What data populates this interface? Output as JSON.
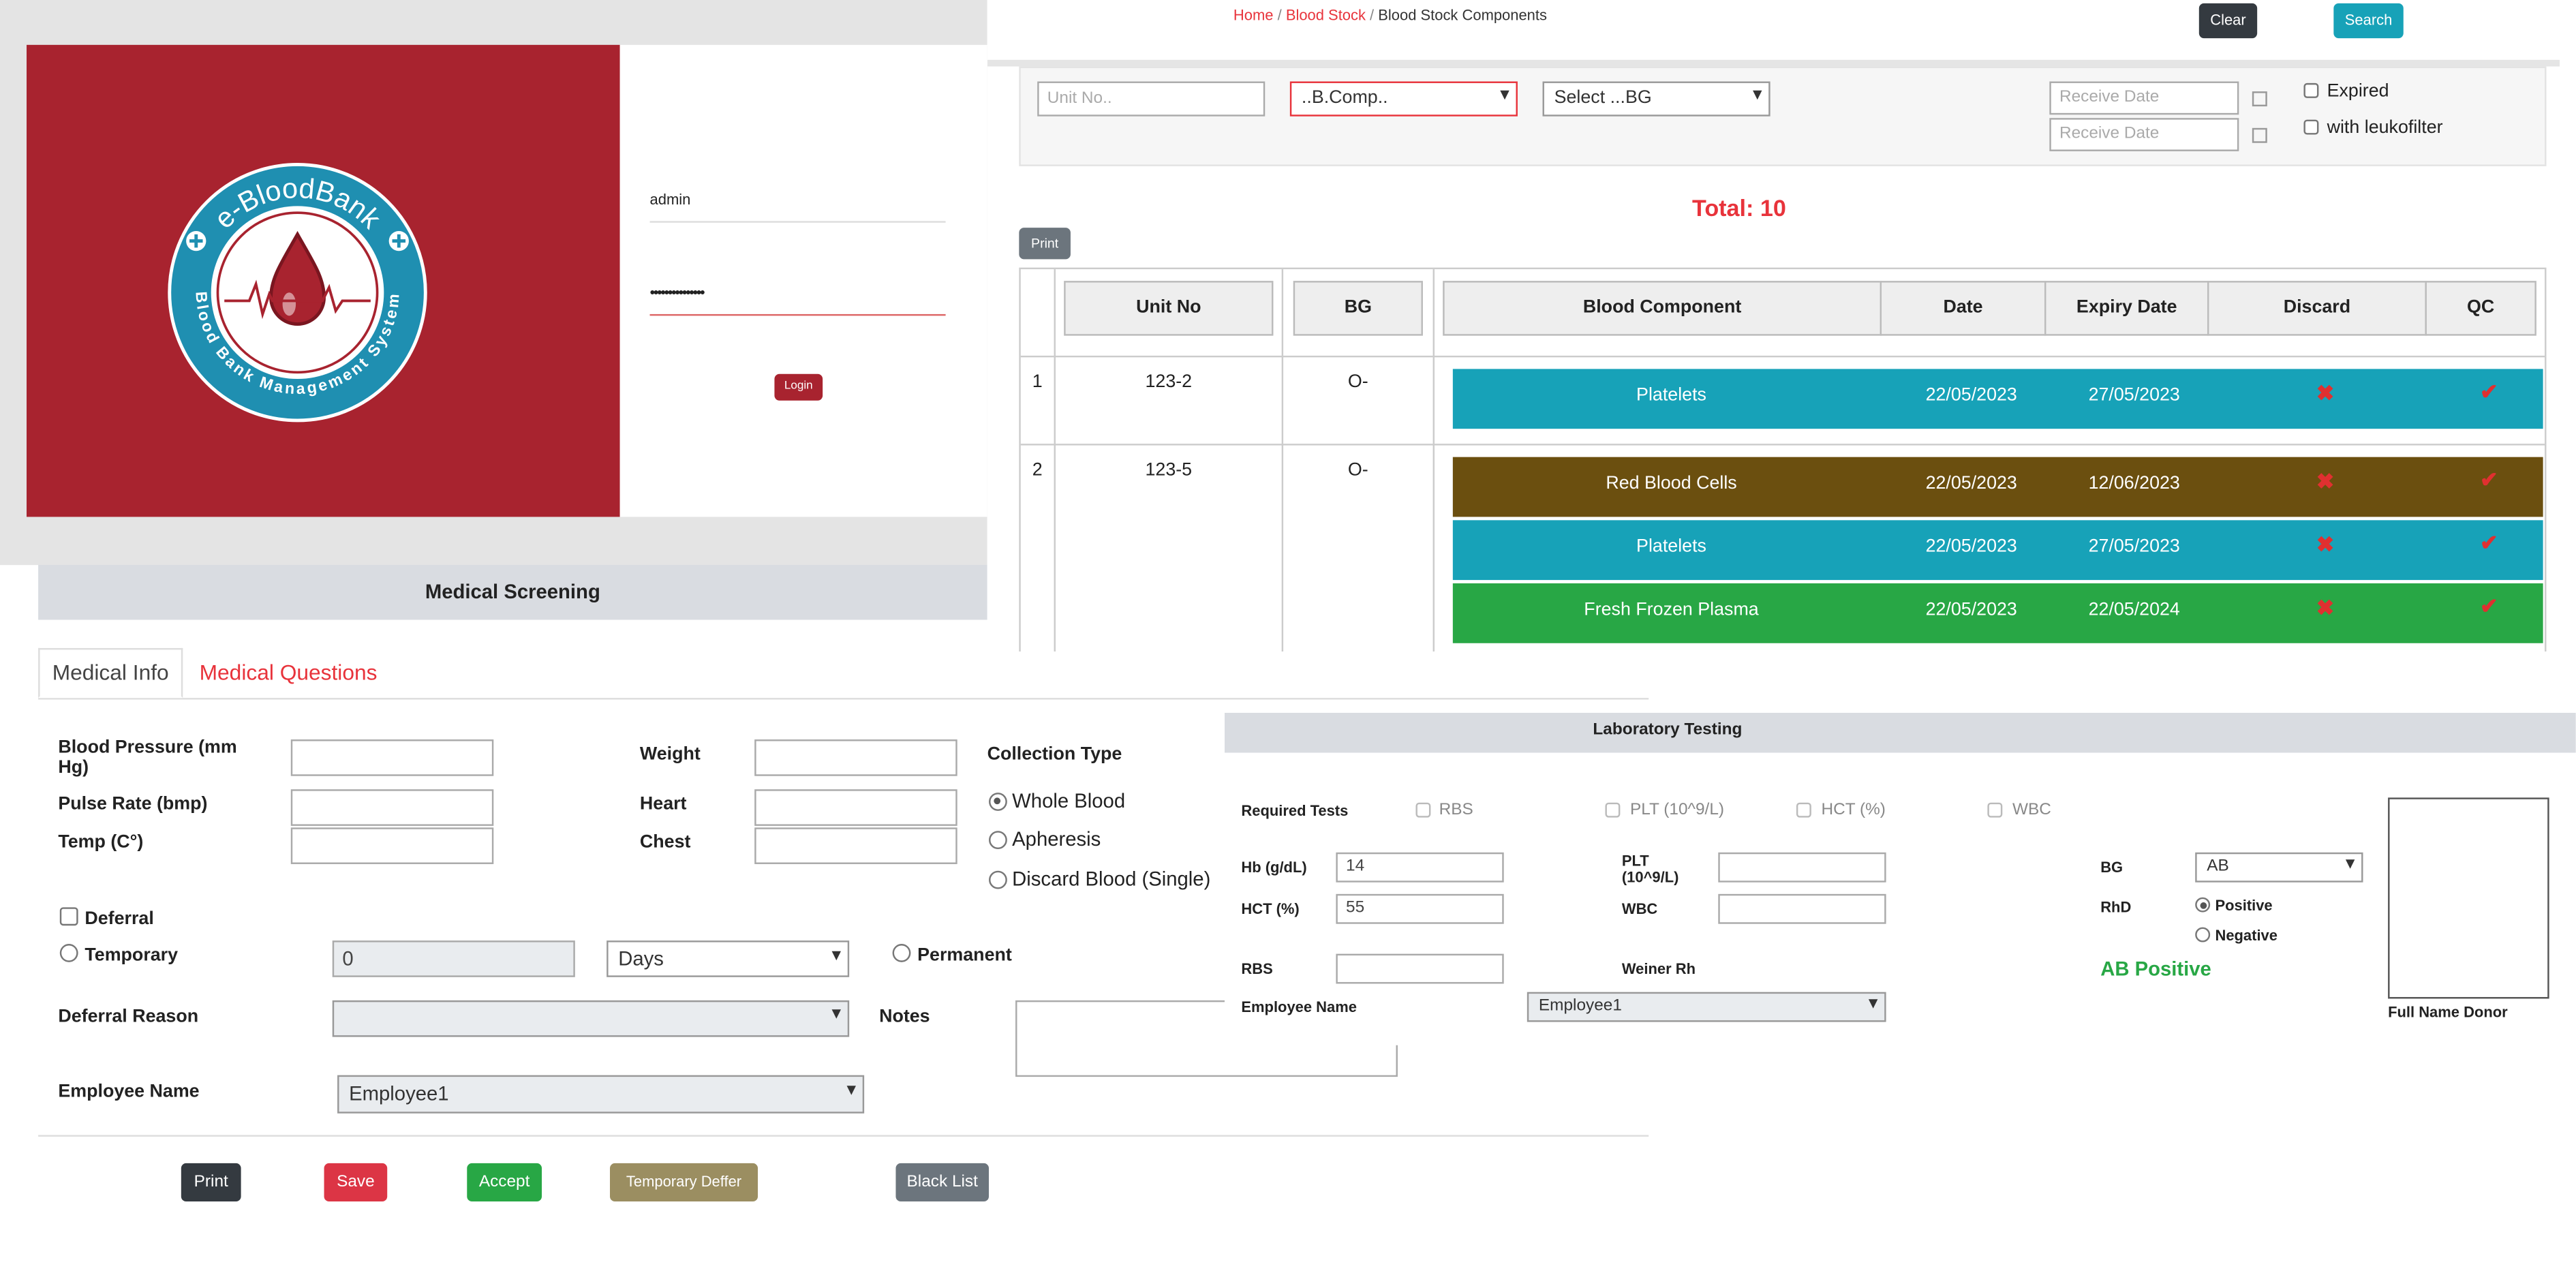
{
  "login": {
    "logo_text": "e-BloodBank",
    "logo_subtext": "Blood Bank Management System",
    "username": "admin",
    "password": "•••••••••••••••",
    "login_label": "Login"
  },
  "stock": {
    "breadcrumb": [
      "Home",
      "Blood Stock",
      "Blood Stock Components"
    ],
    "clear_label": "Clear",
    "search_label": "Search",
    "filters": {
      "unit_placeholder": "Unit No..",
      "component_select": "..B.Comp..",
      "bg_select": "Select ...BG",
      "receive_date_from_placeholder": "Receive Date",
      "receive_date_to_placeholder": "Receive Date",
      "expired_label": "Expired",
      "leukofilter_label": "with leukofilter"
    },
    "total_label": "Total: 10",
    "print_label": "Print",
    "columns": [
      "Unit No",
      "BG",
      "Blood Component",
      "Date",
      "Expiry Date",
      "Discard",
      "QC"
    ],
    "units": [
      {
        "index": "1",
        "unit_no": "123-2",
        "bg": "O-",
        "components": [
          {
            "name": "Platelets",
            "date": "22/05/2023",
            "expiry": "27/05/2023",
            "color": "#17a2b8"
          }
        ]
      },
      {
        "index": "2",
        "unit_no": "123-5",
        "bg": "O-",
        "components": [
          {
            "name": "Red Blood Cells",
            "date": "22/05/2023",
            "expiry": "12/06/2023",
            "color": "#6b4f0f"
          },
          {
            "name": "Platelets",
            "date": "22/05/2023",
            "expiry": "27/05/2023",
            "color": "#17a2b8"
          },
          {
            "name": "Fresh Frozen Plasma",
            "date": "22/05/2023",
            "expiry": "22/05/2024",
            "color": "#28a745"
          }
        ]
      }
    ]
  },
  "screening": {
    "title": "Medical Screening",
    "tabs": [
      "Medical Info",
      "Medical Questions"
    ],
    "blood_pressure_label": "Blood Pressure (mm Hg)",
    "pulse_label": "Pulse Rate (bmp)",
    "temp_label": "Temp (C°)",
    "weight_label": "Weight",
    "heart_label": "Heart",
    "chest_label": "Chest",
    "collection_type_label": "Collection Type",
    "collection_options": [
      "Whole Blood",
      "Apheresis",
      "Discard Blood (Single)"
    ],
    "deferral_label": "Deferral",
    "temporary_label": "Temporary",
    "temporary_value": "0",
    "days_select": "Days",
    "permanent_label": "Permanent",
    "deferral_reason_label": "Deferral Reason",
    "notes_label": "Notes",
    "employee_label": "Employee Name",
    "employee_value": "Employee1",
    "buttons": {
      "print": "Print",
      "save": "Save",
      "accept": "Accept",
      "temp_defer": "Temporary Deffer",
      "black_list": "Black List"
    }
  },
  "lab": {
    "title": "Laboratory Testing",
    "required_tests_label": "Required Tests",
    "tests": [
      "RBS",
      "PLT (10^9/L)",
      "HCT (%)",
      "WBC"
    ],
    "hb_label": "Hb (g/dL)",
    "hb_value": "14",
    "hct_label": "HCT (%)",
    "hct_value": "55",
    "rbs_label": "RBS",
    "plt_label": "PLT (10^9/L)",
    "wbc_label": "WBC",
    "weiner_label": "Weiner Rh",
    "employee_label": "Employee Name",
    "employee_value": "Employee1",
    "bg_label": "BG",
    "bg_value": "AB",
    "rhd_label": "RhD",
    "rhd_positive": "Positive",
    "rhd_negative": "Negative",
    "result": "AB Positive",
    "donor_caption": "Full Name Donor"
  },
  "colors": {
    "brand_red": "#a8232f",
    "accent_red": "#e8333b",
    "teal": "#17a2b8",
    "green": "#28a745",
    "brown": "#6b4f0f"
  }
}
